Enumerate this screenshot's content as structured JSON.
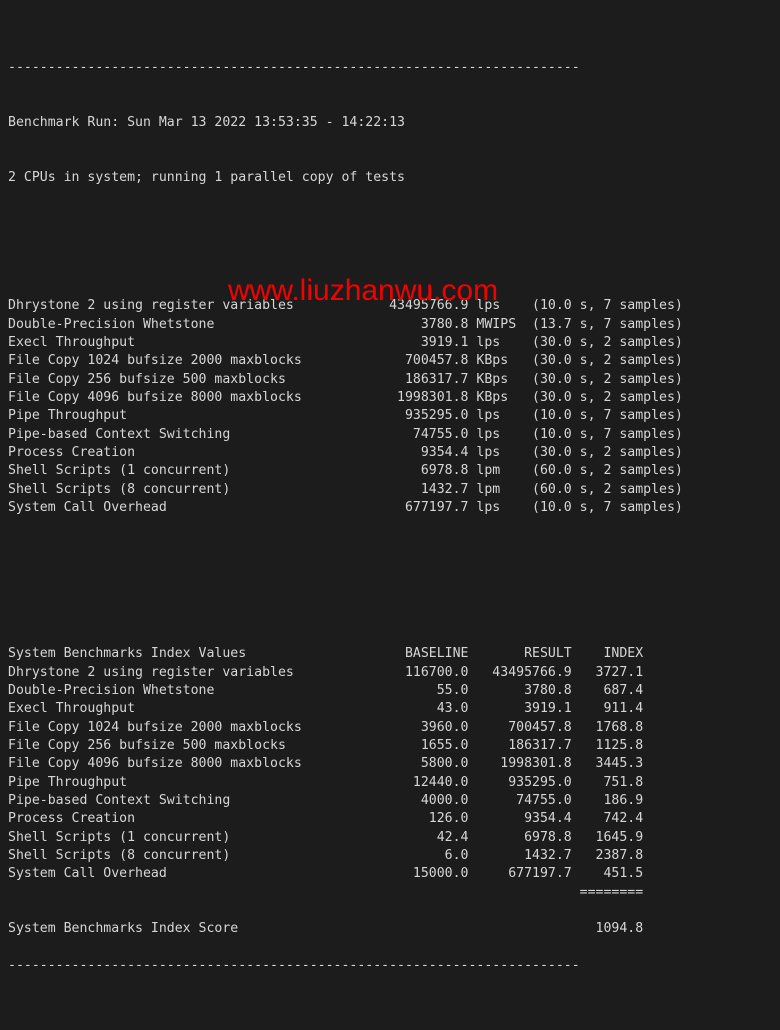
{
  "terminal": {
    "theme": {
      "background": "#1c1c1c",
      "foreground": "#d6d6d6",
      "watermark_color": "#f50000"
    },
    "rule_top": "------------------------------------------------------------------------",
    "rule_bottom": "------------------------------------------------------------------------",
    "header": {
      "run_line": "Benchmark Run: Sun Mar 13 2022 13:53:35 - 14:22:13",
      "cpu_line": "2 CPUs in system; running 1 parallel copy of tests"
    },
    "results": [
      {
        "name": "Dhrystone 2 using register variables",
        "value": "43495766.9",
        "unit": "lps",
        "timing": "(10.0 s, 7 samples)"
      },
      {
        "name": "Double-Precision Whetstone",
        "value": "3780.8",
        "unit": "MWIPS",
        "timing": "(13.7 s, 7 samples)"
      },
      {
        "name": "Execl Throughput",
        "value": "3919.1",
        "unit": "lps",
        "timing": "(30.0 s, 2 samples)"
      },
      {
        "name": "File Copy 1024 bufsize 2000 maxblocks",
        "value": "700457.8",
        "unit": "KBps",
        "timing": "(30.0 s, 2 samples)"
      },
      {
        "name": "File Copy 256 bufsize 500 maxblocks",
        "value": "186317.7",
        "unit": "KBps",
        "timing": "(30.0 s, 2 samples)"
      },
      {
        "name": "File Copy 4096 bufsize 8000 maxblocks",
        "value": "1998301.8",
        "unit": "KBps",
        "timing": "(30.0 s, 2 samples)"
      },
      {
        "name": "Pipe Throughput",
        "value": "935295.0",
        "unit": "lps",
        "timing": "(10.0 s, 7 samples)"
      },
      {
        "name": "Pipe-based Context Switching",
        "value": "74755.0",
        "unit": "lps",
        "timing": "(10.0 s, 7 samples)"
      },
      {
        "name": "Process Creation",
        "value": "9354.4",
        "unit": "lps",
        "timing": "(30.0 s, 2 samples)"
      },
      {
        "name": "Shell Scripts (1 concurrent)",
        "value": "6978.8",
        "unit": "lpm",
        "timing": "(60.0 s, 2 samples)"
      },
      {
        "name": "Shell Scripts (8 concurrent)",
        "value": "1432.7",
        "unit": "lpm",
        "timing": "(60.0 s, 2 samples)"
      },
      {
        "name": "System Call Overhead",
        "value": "677197.7",
        "unit": "lps",
        "timing": "(10.0 s, 7 samples)"
      }
    ],
    "index_table": {
      "title": "System Benchmarks Index Values",
      "columns": [
        "BASELINE",
        "RESULT",
        "INDEX"
      ],
      "rows": [
        {
          "name": "Dhrystone 2 using register variables",
          "baseline": "116700.0",
          "result": "43495766.9",
          "index": "3727.1"
        },
        {
          "name": "Double-Precision Whetstone",
          "baseline": "55.0",
          "result": "3780.8",
          "index": "687.4"
        },
        {
          "name": "Execl Throughput",
          "baseline": "43.0",
          "result": "3919.1",
          "index": "911.4"
        },
        {
          "name": "File Copy 1024 bufsize 2000 maxblocks",
          "baseline": "3960.0",
          "result": "700457.8",
          "index": "1768.8"
        },
        {
          "name": "File Copy 256 bufsize 500 maxblocks",
          "baseline": "1655.0",
          "result": "186317.7",
          "index": "1125.8"
        },
        {
          "name": "File Copy 4096 bufsize 8000 maxblocks",
          "baseline": "5800.0",
          "result": "1998301.8",
          "index": "3445.3"
        },
        {
          "name": "Pipe Throughput",
          "baseline": "12440.0",
          "result": "935295.0",
          "index": "751.8"
        },
        {
          "name": "Pipe-based Context Switching",
          "baseline": "4000.0",
          "result": "74755.0",
          "index": "186.9"
        },
        {
          "name": "Process Creation",
          "baseline": "126.0",
          "result": "9354.4",
          "index": "742.4"
        },
        {
          "name": "Shell Scripts (1 concurrent)",
          "baseline": "42.4",
          "result": "6978.8",
          "index": "1645.9"
        },
        {
          "name": "Shell Scripts (8 concurrent)",
          "baseline": "6.0",
          "result": "1432.7",
          "index": "2387.8"
        },
        {
          "name": "System Call Overhead",
          "baseline": "15000.0",
          "result": "677197.7",
          "index": "451.5"
        }
      ],
      "separator": "========",
      "score_label": "System Benchmarks Index Score",
      "score_value": "1094.8"
    },
    "watermark": "www.liuzhanwu.com"
  }
}
